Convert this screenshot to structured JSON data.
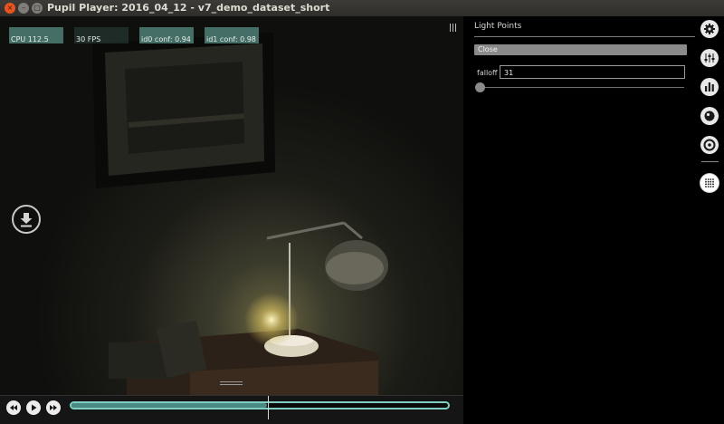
{
  "window": {
    "title": "Pupil Player: 2016_04_12 - v7_demo_dataset_short",
    "close_glyph": "×",
    "min_glyph": "–",
    "max_glyph": "□"
  },
  "stats": [
    {
      "label": "CPU 112.5",
      "level": 0.55
    },
    {
      "label": "30 FPS",
      "level": 0.65
    },
    {
      "label": "id0 conf: 0.94",
      "level": 0.94
    },
    {
      "label": "id1 conf: 0.98",
      "level": 0.98
    }
  ],
  "icons": {
    "menu": "hamburger-menu-icon",
    "download": "download-icon",
    "rewind": "rewind-icon",
    "play": "play-icon",
    "forward": "fast-forward-icon",
    "settings": "gear-icon",
    "plugins": "sliders-icon",
    "charts": "bar-chart-icon",
    "fixation": "fixation-icon",
    "gaze": "target-icon",
    "lightpoints": "light-points-icon"
  },
  "playback": {
    "progress": 0.52
  },
  "panel": {
    "title": "Light Points",
    "close_label": "Close",
    "falloff_label": "falloff",
    "falloff_value": "31",
    "falloff_slider_level": 0.0
  },
  "colors": {
    "accent": "#7fcfc3",
    "stat_bar": "#4f7f78",
    "titlebar_close": "#e95420"
  }
}
